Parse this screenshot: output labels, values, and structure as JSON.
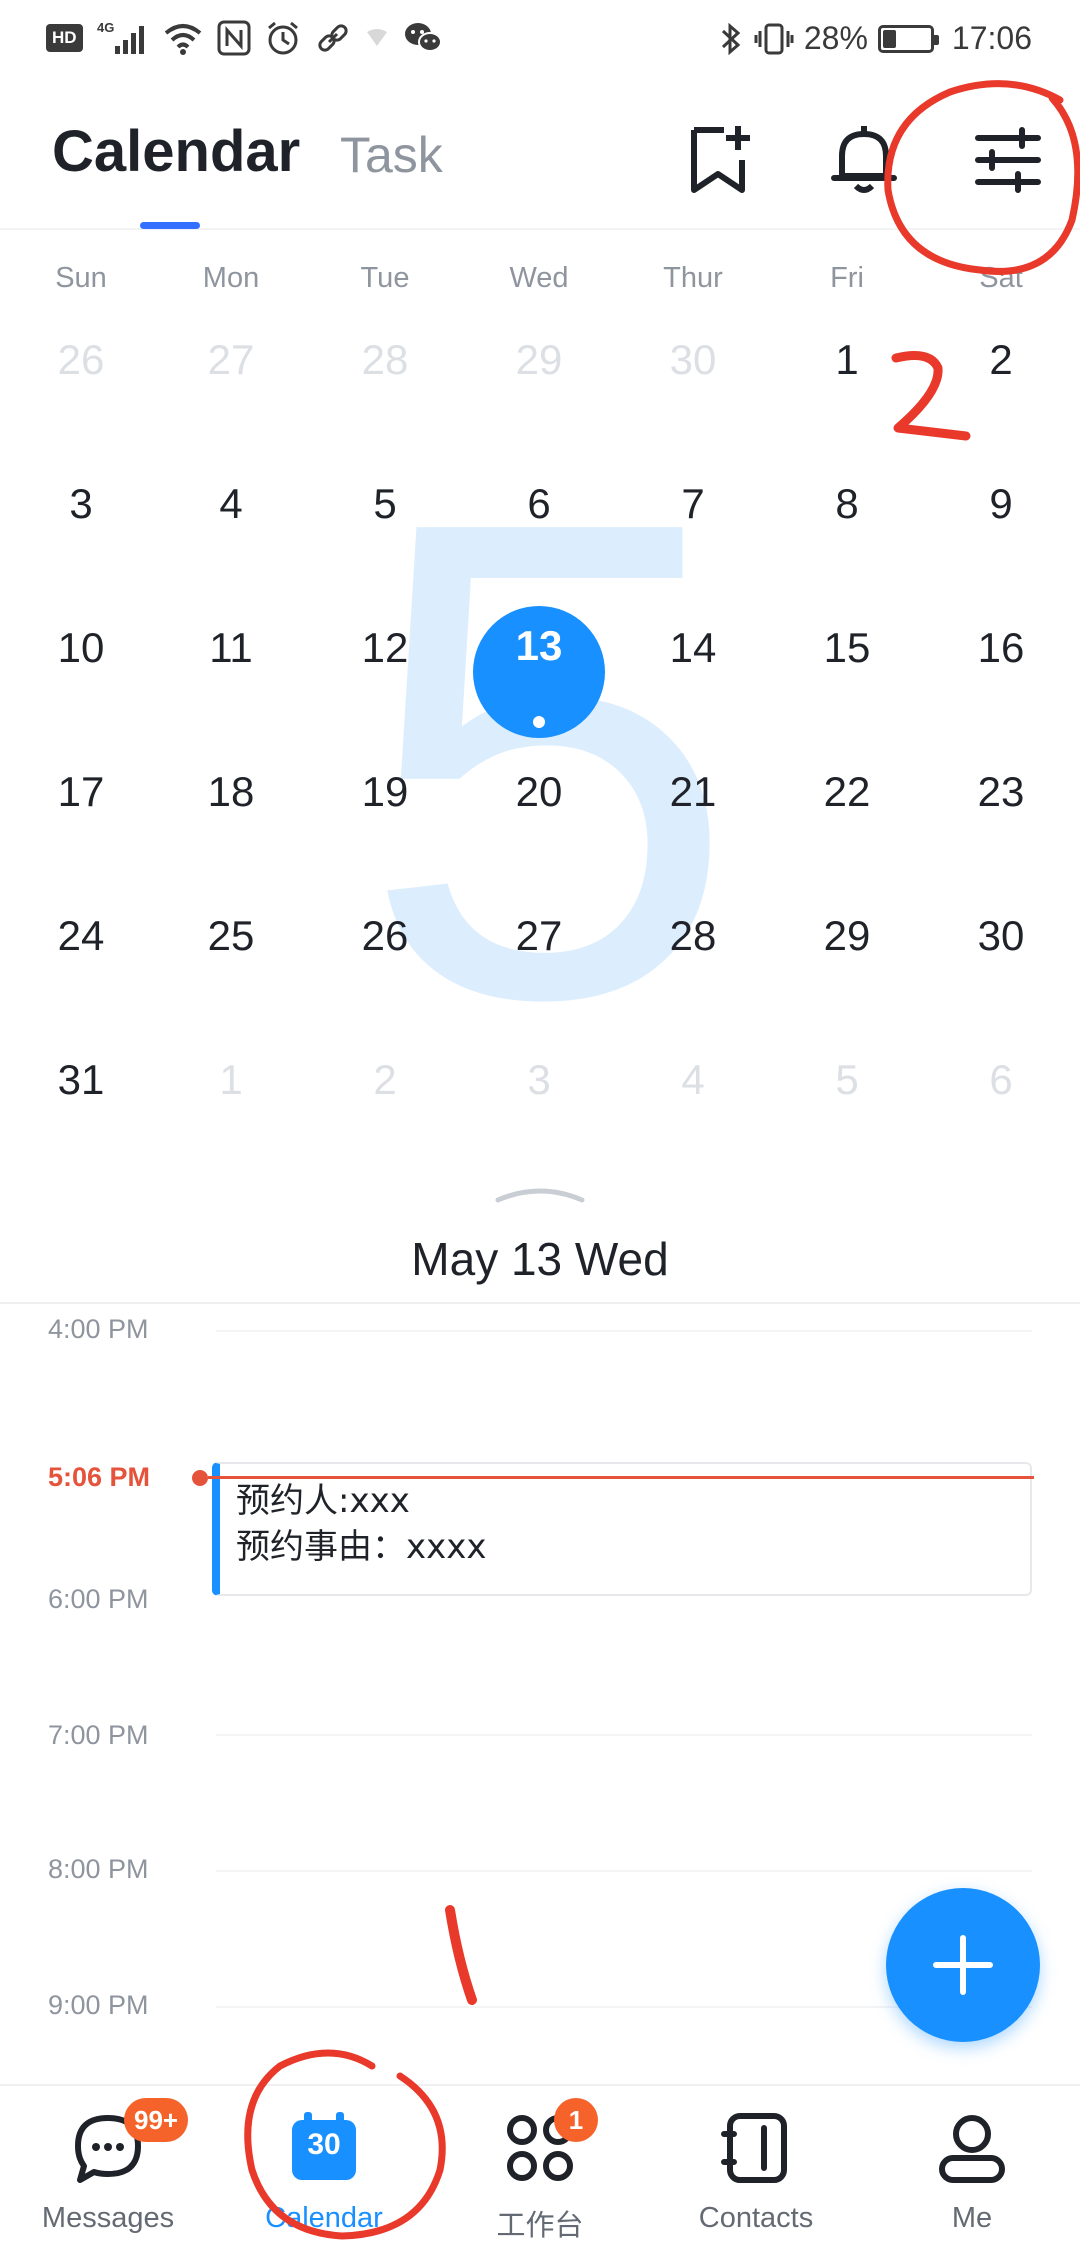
{
  "status_bar": {
    "left_glyphs": [
      "HD",
      "4G",
      "wifi",
      "nfc",
      "alarm",
      "link",
      "wechat"
    ],
    "battery_percent": "28%",
    "battery_level": 0.28,
    "time": "17:06"
  },
  "header": {
    "tab_calendar": "Calendar",
    "tab_task": "Task",
    "icons": [
      "bookmark-add-icon",
      "bell-icon",
      "filter-settings-icon"
    ]
  },
  "calendar": {
    "weekdays": [
      "Sun",
      "Mon",
      "Tue",
      "Wed",
      "Thur",
      "Fri",
      "Sat"
    ],
    "month_watermark": "5",
    "weeks": [
      [
        {
          "d": "26",
          "m": true
        },
        {
          "d": "27",
          "m": true
        },
        {
          "d": "28",
          "m": true
        },
        {
          "d": "29",
          "m": true
        },
        {
          "d": "30",
          "m": true
        },
        {
          "d": "1",
          "m": false
        },
        {
          "d": "2",
          "m": false
        }
      ],
      [
        {
          "d": "3",
          "m": false
        },
        {
          "d": "4",
          "m": false
        },
        {
          "d": "5",
          "m": false
        },
        {
          "d": "6",
          "m": false
        },
        {
          "d": "7",
          "m": false
        },
        {
          "d": "8",
          "m": false
        },
        {
          "d": "9",
          "m": false
        }
      ],
      [
        {
          "d": "10",
          "m": false
        },
        {
          "d": "11",
          "m": false
        },
        {
          "d": "12",
          "m": false
        },
        {
          "d": "13",
          "m": false
        },
        {
          "d": "14",
          "m": false
        },
        {
          "d": "15",
          "m": false
        },
        {
          "d": "16",
          "m": false
        }
      ],
      [
        {
          "d": "17",
          "m": false
        },
        {
          "d": "18",
          "m": false
        },
        {
          "d": "19",
          "m": false
        },
        {
          "d": "20",
          "m": false
        },
        {
          "d": "21",
          "m": false
        },
        {
          "d": "22",
          "m": false
        },
        {
          "d": "23",
          "m": false
        }
      ],
      [
        {
          "d": "24",
          "m": false
        },
        {
          "d": "25",
          "m": false
        },
        {
          "d": "26",
          "m": false
        },
        {
          "d": "27",
          "m": false
        },
        {
          "d": "28",
          "m": false
        },
        {
          "d": "29",
          "m": false
        },
        {
          "d": "30",
          "m": false
        }
      ],
      [
        {
          "d": "31",
          "m": false
        },
        {
          "d": "1",
          "m": true
        },
        {
          "d": "2",
          "m": true
        },
        {
          "d": "3",
          "m": true
        },
        {
          "d": "4",
          "m": true
        },
        {
          "d": "5",
          "m": true
        },
        {
          "d": "6",
          "m": true
        }
      ]
    ],
    "selected_day": "13",
    "selected_date_label": "May 13 Wed"
  },
  "timeline": {
    "slots": [
      "4:00 PM",
      "5:06 PM",
      "6:00 PM",
      "7:00 PM",
      "8:00 PM",
      "9:00 PM"
    ],
    "now_label": "5:06 PM",
    "event": {
      "line1": "预约人:xxx",
      "line2": "预约事由：xxxx"
    }
  },
  "bottom_nav": {
    "messages": {
      "label": "Messages",
      "badge": "99+"
    },
    "calendar": {
      "label": "Calendar",
      "icon_number": "30"
    },
    "workbench": {
      "label": "工作台",
      "badge": "1"
    },
    "contacts": {
      "label": "Contacts"
    },
    "me": {
      "label": "Me"
    }
  },
  "annotations": {
    "mark_1": "1",
    "mark_2": "2"
  },
  "colors": {
    "accent": "#1890ff",
    "now_red": "#e5533b",
    "badge_orange": "#f5632a",
    "annotation_red": "#e8392b"
  }
}
